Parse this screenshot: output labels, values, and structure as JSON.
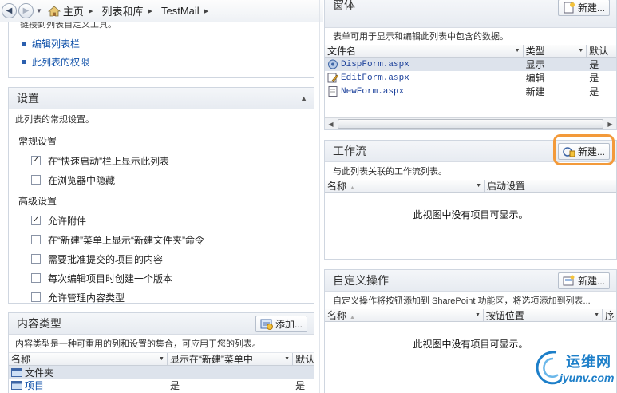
{
  "breadcrumb": {
    "items": [
      "主页",
      "列表和库",
      "TestMail"
    ]
  },
  "customize": {
    "desc": "链接到列表自定义工具。",
    "links": [
      "编辑列表栏",
      "此列表的权限"
    ]
  },
  "settings": {
    "title": "设置",
    "desc": "此列表的常规设置。",
    "general_label": "常规设置",
    "general_options": [
      {
        "label": "在“快速启动”栏上显示此列表",
        "checked": true
      },
      {
        "label": "在浏览器中隐藏",
        "checked": false
      }
    ],
    "advanced_label": "高级设置",
    "advanced_options": [
      {
        "label": "允许附件",
        "checked": true
      },
      {
        "label": "在“新建”菜单上显示“新建文件夹”命令",
        "checked": false
      },
      {
        "label": "需要批准提交的项目的内容",
        "checked": false
      },
      {
        "label": "每次编辑项目时创建一个版本",
        "checked": false
      },
      {
        "label": "允许管理内容类型",
        "checked": false
      }
    ]
  },
  "content_types": {
    "title": "内容类型",
    "add_label": "添加...",
    "desc": "内容类型是一种可重用的列和设置的集合，可应用于您的列表。",
    "columns": [
      "名称",
      "显示在“新建”菜单中",
      "默认"
    ],
    "rows": [
      {
        "name": "文件夹",
        "show": "",
        "default": ""
      },
      {
        "name": "项目",
        "show": "是",
        "default": "是"
      }
    ]
  },
  "forms": {
    "title": "窗体",
    "new_label": "新建...",
    "desc": "表单可用于显示和编辑此列表中包含的数据。",
    "columns": [
      "文件名",
      "类型",
      "默认"
    ],
    "rows": [
      {
        "name": "DispForm.aspx",
        "type": "显示",
        "default": "是"
      },
      {
        "name": "EditForm.aspx",
        "type": "编辑",
        "default": "是"
      },
      {
        "name": "NewForm.aspx",
        "type": "新建",
        "default": "是"
      }
    ]
  },
  "workflow": {
    "title": "工作流",
    "new_label": "新建...",
    "desc": "与此列表关联的工作流列表。",
    "columns": [
      "名称",
      "启动设置"
    ],
    "empty": "此视图中没有项目可显示。"
  },
  "custom_actions": {
    "title": "自定义操作",
    "new_label": "新建...",
    "desc": "自定义操作将按钮添加到 SharePoint 功能区，将选项添加到列表...",
    "columns": [
      "名称",
      "按钮位置",
      "序"
    ],
    "empty": "此视图中没有项目可显示。"
  },
  "watermark": {
    "text1": "运维网",
    "text2": "iyunv.com"
  },
  "colors": {
    "link": "#0b4ea8",
    "highlight": "#f39a3a",
    "watermark": "#1d7fc9"
  }
}
